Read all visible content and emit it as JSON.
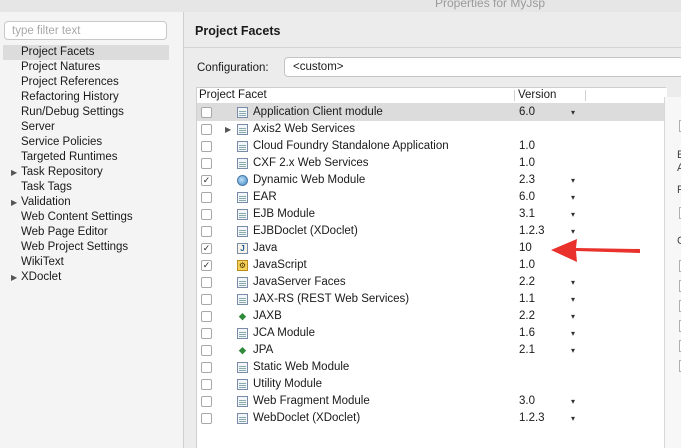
{
  "window": {
    "title": "Properties for MyJsp"
  },
  "sidebar": {
    "filter_placeholder": "type filter text",
    "items": [
      {
        "label": "Project Facets",
        "selected": true,
        "expandable": false
      },
      {
        "label": "Project Natures",
        "selected": false,
        "expandable": false
      },
      {
        "label": "Project References",
        "selected": false,
        "expandable": false
      },
      {
        "label": "Refactoring History",
        "selected": false,
        "expandable": false
      },
      {
        "label": "Run/Debug Settings",
        "selected": false,
        "expandable": false
      },
      {
        "label": "Server",
        "selected": false,
        "expandable": false
      },
      {
        "label": "Service Policies",
        "selected": false,
        "expandable": false
      },
      {
        "label": "Targeted Runtimes",
        "selected": false,
        "expandable": false
      },
      {
        "label": "Task Repository",
        "selected": false,
        "expandable": true
      },
      {
        "label": "Task Tags",
        "selected": false,
        "expandable": false
      },
      {
        "label": "Validation",
        "selected": false,
        "expandable": true
      },
      {
        "label": "Web Content Settings",
        "selected": false,
        "expandable": false
      },
      {
        "label": "Web Page Editor",
        "selected": false,
        "expandable": false
      },
      {
        "label": "Web Project Settings",
        "selected": false,
        "expandable": false
      },
      {
        "label": "WikiText",
        "selected": false,
        "expandable": false
      },
      {
        "label": "XDoclet",
        "selected": false,
        "expandable": true
      }
    ]
  },
  "main": {
    "title": "Project Facets",
    "configuration": {
      "label": "Configuration:",
      "value": "<custom>"
    },
    "table": {
      "columns": {
        "facet": "Project Facet",
        "version": "Version"
      },
      "rows": [
        {
          "label": "Application Client module",
          "version": "6.0",
          "checked": false,
          "selected": true,
          "dropdown": true,
          "expander": false,
          "icon": "doc-icon"
        },
        {
          "label": "Axis2 Web Services",
          "version": "",
          "checked": false,
          "selected": false,
          "dropdown": false,
          "expander": true,
          "icon": "doc-icon"
        },
        {
          "label": "Cloud Foundry Standalone Application",
          "version": "1.0",
          "checked": false,
          "selected": false,
          "dropdown": false,
          "expander": false,
          "icon": "doc-icon"
        },
        {
          "label": "CXF 2.x Web Services",
          "version": "1.0",
          "checked": false,
          "selected": false,
          "dropdown": false,
          "expander": false,
          "icon": "doc-icon"
        },
        {
          "label": "Dynamic Web Module",
          "version": "2.3",
          "checked": true,
          "selected": false,
          "dropdown": true,
          "expander": false,
          "icon": "globe-icon"
        },
        {
          "label": "EAR",
          "version": "6.0",
          "checked": false,
          "selected": false,
          "dropdown": true,
          "expander": false,
          "icon": "doc-icon"
        },
        {
          "label": "EJB Module",
          "version": "3.1",
          "checked": false,
          "selected": false,
          "dropdown": true,
          "expander": false,
          "icon": "ejb-icon"
        },
        {
          "label": "EJBDoclet (XDoclet)",
          "version": "1.2.3",
          "checked": false,
          "selected": false,
          "dropdown": true,
          "expander": false,
          "icon": "doc-icon"
        },
        {
          "label": "Java",
          "version": "10",
          "checked": true,
          "selected": false,
          "dropdown": true,
          "expander": false,
          "icon": "java-icon"
        },
        {
          "label": "JavaScript",
          "version": "1.0",
          "checked": true,
          "selected": false,
          "dropdown": false,
          "expander": false,
          "icon": "javascript-icon"
        },
        {
          "label": "JavaServer Faces",
          "version": "2.2",
          "checked": false,
          "selected": false,
          "dropdown": true,
          "expander": false,
          "icon": "doc-icon"
        },
        {
          "label": "JAX-RS (REST Web Services)",
          "version": "1.1",
          "checked": false,
          "selected": false,
          "dropdown": true,
          "expander": false,
          "icon": "doc-icon"
        },
        {
          "label": "JAXB",
          "version": "2.2",
          "checked": false,
          "selected": false,
          "dropdown": true,
          "expander": false,
          "icon": "jaxb-icon"
        },
        {
          "label": "JCA Module",
          "version": "1.6",
          "checked": false,
          "selected": false,
          "dropdown": true,
          "expander": false,
          "icon": "doc-icon"
        },
        {
          "label": "JPA",
          "version": "2.1",
          "checked": false,
          "selected": false,
          "dropdown": true,
          "expander": false,
          "icon": "jpa-icon"
        },
        {
          "label": "Static Web Module",
          "version": "",
          "checked": false,
          "selected": false,
          "dropdown": false,
          "expander": false,
          "icon": "doc-icon"
        },
        {
          "label": "Utility Module",
          "version": "",
          "checked": false,
          "selected": false,
          "dropdown": false,
          "expander": false,
          "icon": "doc-icon"
        },
        {
          "label": "Web Fragment Module",
          "version": "3.0",
          "checked": false,
          "selected": false,
          "dropdown": true,
          "expander": false,
          "icon": "doc-icon"
        },
        {
          "label": "WebDoclet (XDoclet)",
          "version": "1.2.3",
          "checked": false,
          "selected": false,
          "dropdown": true,
          "expander": false,
          "icon": "doc-icon"
        }
      ]
    }
  },
  "right_panel": {
    "fragments": [
      "E",
      "A",
      "R",
      "C"
    ]
  },
  "colors": {
    "annotation_arrow": "#e8322b",
    "selection": "#dcdcdc"
  }
}
